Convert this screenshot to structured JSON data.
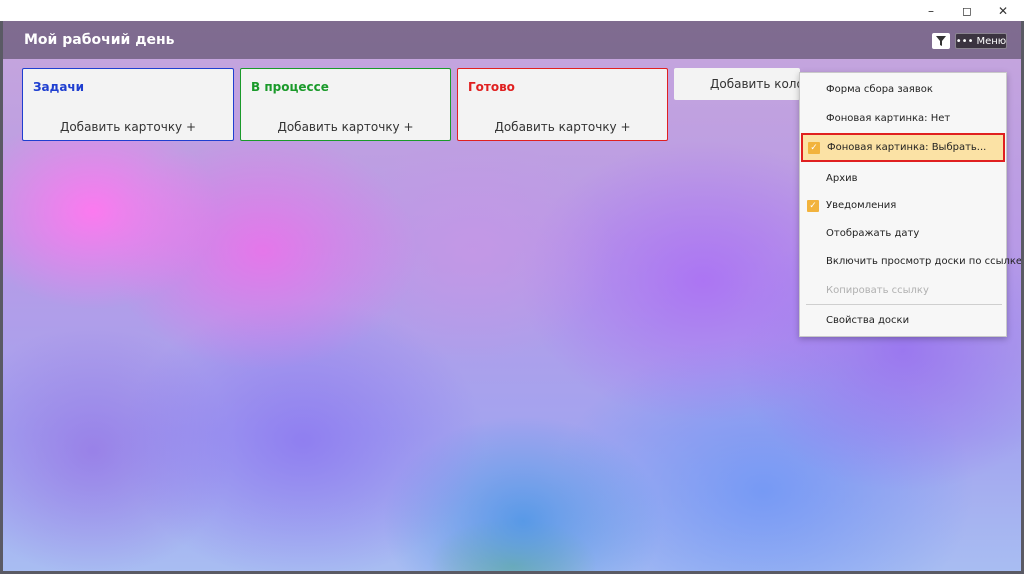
{
  "window": {
    "minimize_glyph": "–",
    "maximize_glyph": "◻",
    "close_glyph": "✕"
  },
  "board": {
    "title": "Мой рабочий день",
    "filter_icon": "filter-icon",
    "menu_button": {
      "dots": "•••",
      "label": "Меню"
    }
  },
  "columns": [
    {
      "title": "Задачи",
      "add_label": "Добавить карточку +",
      "color": "#1f3fd0"
    },
    {
      "title": "В процессе",
      "add_label": "Добавить карточку +",
      "color": "#1a9a2a"
    },
    {
      "title": "Готово",
      "add_label": "Добавить карточку +",
      "color": "#e02020"
    }
  ],
  "add_column": {
    "label": "Добавить колонку"
  },
  "menu": {
    "items": [
      {
        "label": "Форма сбора заявок",
        "checked": false,
        "disabled": false
      },
      {
        "label": "Фоновая картинка: Нет",
        "checked": false,
        "disabled": false
      },
      {
        "label": "Фоновая картинка: Выбрать...",
        "checked": true,
        "disabled": false,
        "highlighted": true
      },
      {
        "label": "Архив",
        "checked": false,
        "disabled": false
      },
      {
        "label": "Уведомления",
        "checked": true,
        "disabled": false
      },
      {
        "label": "Отображать дату",
        "checked": false,
        "disabled": false
      },
      {
        "label": "Включить просмотр доски по ссылке",
        "checked": false,
        "disabled": false
      },
      {
        "label": "Копировать ссылку",
        "checked": false,
        "disabled": true
      },
      {
        "label": "Свойства доски",
        "checked": false,
        "disabled": false
      }
    ],
    "check_glyph": "✓"
  },
  "colors": {
    "check_accent": "#f2b33d",
    "highlight_bg": "#fbe2a5",
    "highlight_border": "#e02020"
  }
}
